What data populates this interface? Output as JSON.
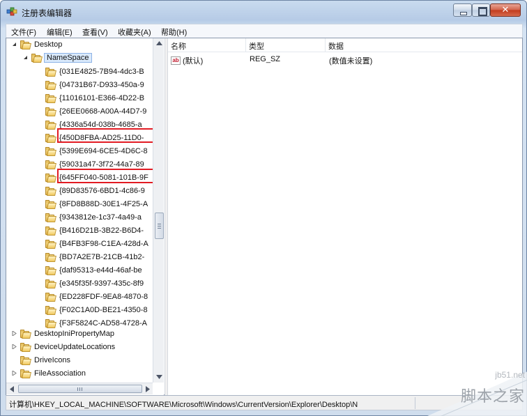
{
  "window": {
    "title": "注册表编辑器",
    "close_glyph": "✕"
  },
  "menu": [
    "文件(F)",
    "编辑(E)",
    "查看(V)",
    "收藏夹(A)",
    "帮助(H)"
  ],
  "tree": {
    "root": "Desktop",
    "selected": "NameSpace",
    "namespace_children": [
      "{031E4825-7B94-4dc3-B",
      "{04731B67-D933-450a-9",
      "{11016101-E366-4D22-B",
      "{26EE0668-A00A-44D7-9",
      "{4336a54d-038b-4685-a",
      "{450D8FBA-AD25-11D0-",
      "{5399E694-6CE5-4D6C-8",
      "{59031a47-3f72-44a7-89",
      "{645FF040-5081-101B-9F",
      "{89D83576-6BD1-4c86-9",
      "{8FD8B88D-30E1-4F25-A",
      "{9343812e-1c37-4a49-a",
      "{B416D21B-3B22-B6D4-",
      "{B4FB3F98-C1EA-428d-A",
      "{BD7A2E7B-21CB-41b2-",
      "{daf95313-e44d-46af-be",
      "{e345f35f-9397-435c-8f9",
      "{ED228FDF-9EA8-4870-8",
      "{F02C1A0D-BE21-4350-8",
      "{F3F5824C-AD58-4728-A"
    ],
    "sibling_keys": [
      "DesktopIniPropertyMap",
      "DeviceUpdateLocations",
      "DriveIcons",
      "FileAssociation"
    ]
  },
  "values_pane": {
    "headers": {
      "name": "名称",
      "type": "类型",
      "data": "数据"
    },
    "rows": [
      {
        "icon": "string-value-icon",
        "icon_text": "ab",
        "name": "(默认)",
        "type": "REG_SZ",
        "data": "(数值未设置)"
      }
    ]
  },
  "statusbar": {
    "path": "计算机\\HKEY_LOCAL_MACHINE\\SOFTWARE\\Microsoft\\Windows\\CurrentVersion\\Explorer\\Desktop\\N"
  },
  "watermark": {
    "site": "jb51.net",
    "name": "脚本之家"
  },
  "colors": {
    "highlight_box": "#e21b23",
    "folder": "#f1c95f",
    "selection": "#d9e9fb"
  }
}
